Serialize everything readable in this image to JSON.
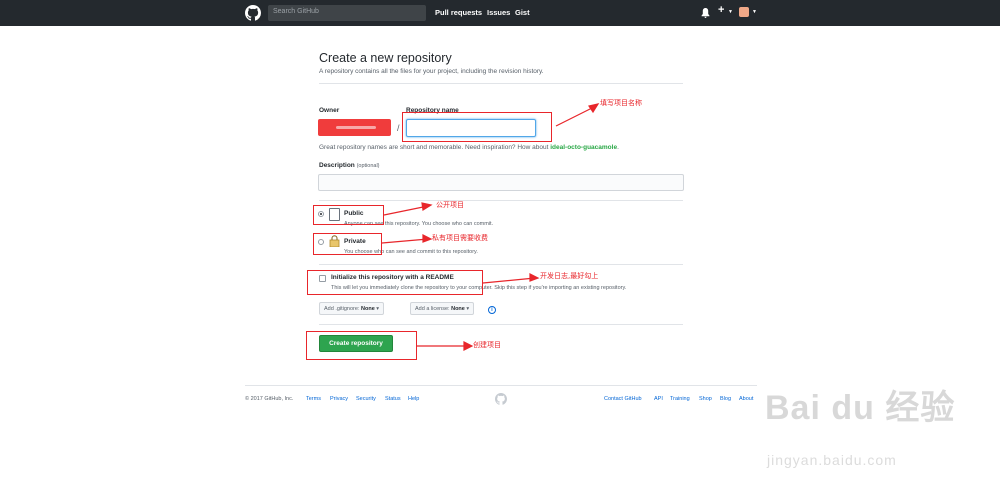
{
  "header": {
    "search_placeholder": "Search GitHub",
    "nav": [
      "Pull requests",
      "Issues",
      "Gist"
    ],
    "plus": "+"
  },
  "page": {
    "title": "Create a new repository",
    "subtitle": "A repository contains all the files for your project, including the revision history.",
    "owner_label": "Owner",
    "repo_name_label": "Repository name",
    "slash": "/",
    "repo_name_value": "",
    "hint_prefix": "Great repository names are short and memorable. Need inspiration? How about ",
    "hint_suggestion": "ideal-octo-guacamole",
    "hint_suffix": ".",
    "description_label": "Description",
    "description_optional": "(optional)",
    "description_value": ""
  },
  "visibility": {
    "selected": "public",
    "public": {
      "title": "Public",
      "note": "Anyone can see this repository. You choose who can commit."
    },
    "private": {
      "title": "Private",
      "note": "You choose who can see and commit to this repository."
    }
  },
  "readme": {
    "checked": false,
    "title": "Initialize this repository with a README",
    "note": "This will let you immediately clone the repository to your computer. Skip this step if you're importing an existing repository."
  },
  "dropdowns": {
    "gitignore_label": "Add .gitignore:",
    "gitignore_value": "None",
    "license_label": "Add a license:",
    "license_value": "None"
  },
  "create_button": "Create repository",
  "annotations": {
    "repo_name": "填写项目名称",
    "public": "公开项目",
    "private": "私有项目需要收费",
    "readme": "开发日志,最好勾上",
    "create": "创建项目"
  },
  "footer": {
    "copyright": "© 2017 GitHub, Inc.",
    "left_links": [
      "Terms",
      "Privacy",
      "Security",
      "Status",
      "Help"
    ],
    "right_links": [
      "Contact GitHub",
      "API",
      "Training",
      "Shop",
      "Blog",
      "About"
    ]
  },
  "watermark": {
    "logo": "Bai du 经验",
    "url": "jingyan.baidu.com"
  },
  "colors": {
    "header_bg": "#24292e",
    "create_button": "#2ea44f",
    "annotation": "#e8262b",
    "suggestion": "#28a745"
  }
}
